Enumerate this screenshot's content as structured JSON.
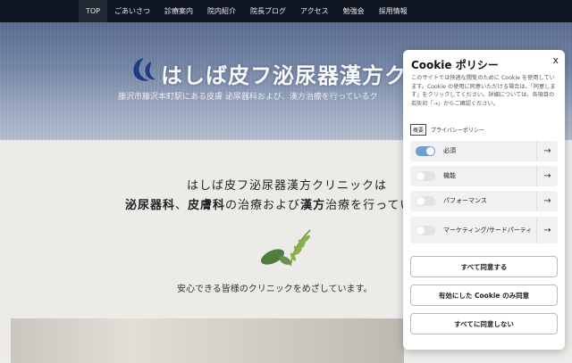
{
  "nav": {
    "items": [
      "TOP",
      "ごあいさつ",
      "診療案内",
      "院内紹介",
      "院長ブログ",
      "アクセス",
      "勉強会",
      "採用情報"
    ]
  },
  "hero": {
    "title": "はしば皮フ泌尿器漢方クリニ",
    "subtitle": "藤沢市藤沢本町駅にある皮膚 泌尿器科および、漢方治療を行っているク"
  },
  "main": {
    "lead1": "はしば皮フ泌尿器漢方クリニックは",
    "lead2_a": "泌尿器科",
    "lead2_b": "、",
    "lead2_c": "皮膚科",
    "lead2_d": "の治療および",
    "lead2_e": "漢方",
    "lead2_f": "治療を行ってい",
    "tagline": "安心できる皆様のクリニックをめざしています。"
  },
  "cookie": {
    "title": "Cookie ポリシー",
    "close": "x",
    "text": "このサイトでは快適な閲覧のために Cookie を使用しています。Cookie の使用に同意いただける場合は、「同意します」をクリックしてください。詳細については、各項目の右矢印「→」からご確認ください。",
    "link_box": "概要",
    "link": "プライバシーポリシー",
    "categories": [
      {
        "label": "必須",
        "enabled": true
      },
      {
        "label": "機能",
        "enabled": false
      },
      {
        "label": "パフォーマンス",
        "enabled": false
      },
      {
        "label": "マーケティング/サードパーティ",
        "enabled": false
      }
    ],
    "arrow": "→",
    "buttons": {
      "accept_all": "すべて同意する",
      "accept_enabled": "有効にした Cookie のみ同意",
      "reject_all": "すべてに同意しない"
    }
  },
  "colors": {
    "nav_bg": "#111722",
    "accent": "#6f9fcf",
    "logo": "#1a3a86"
  }
}
